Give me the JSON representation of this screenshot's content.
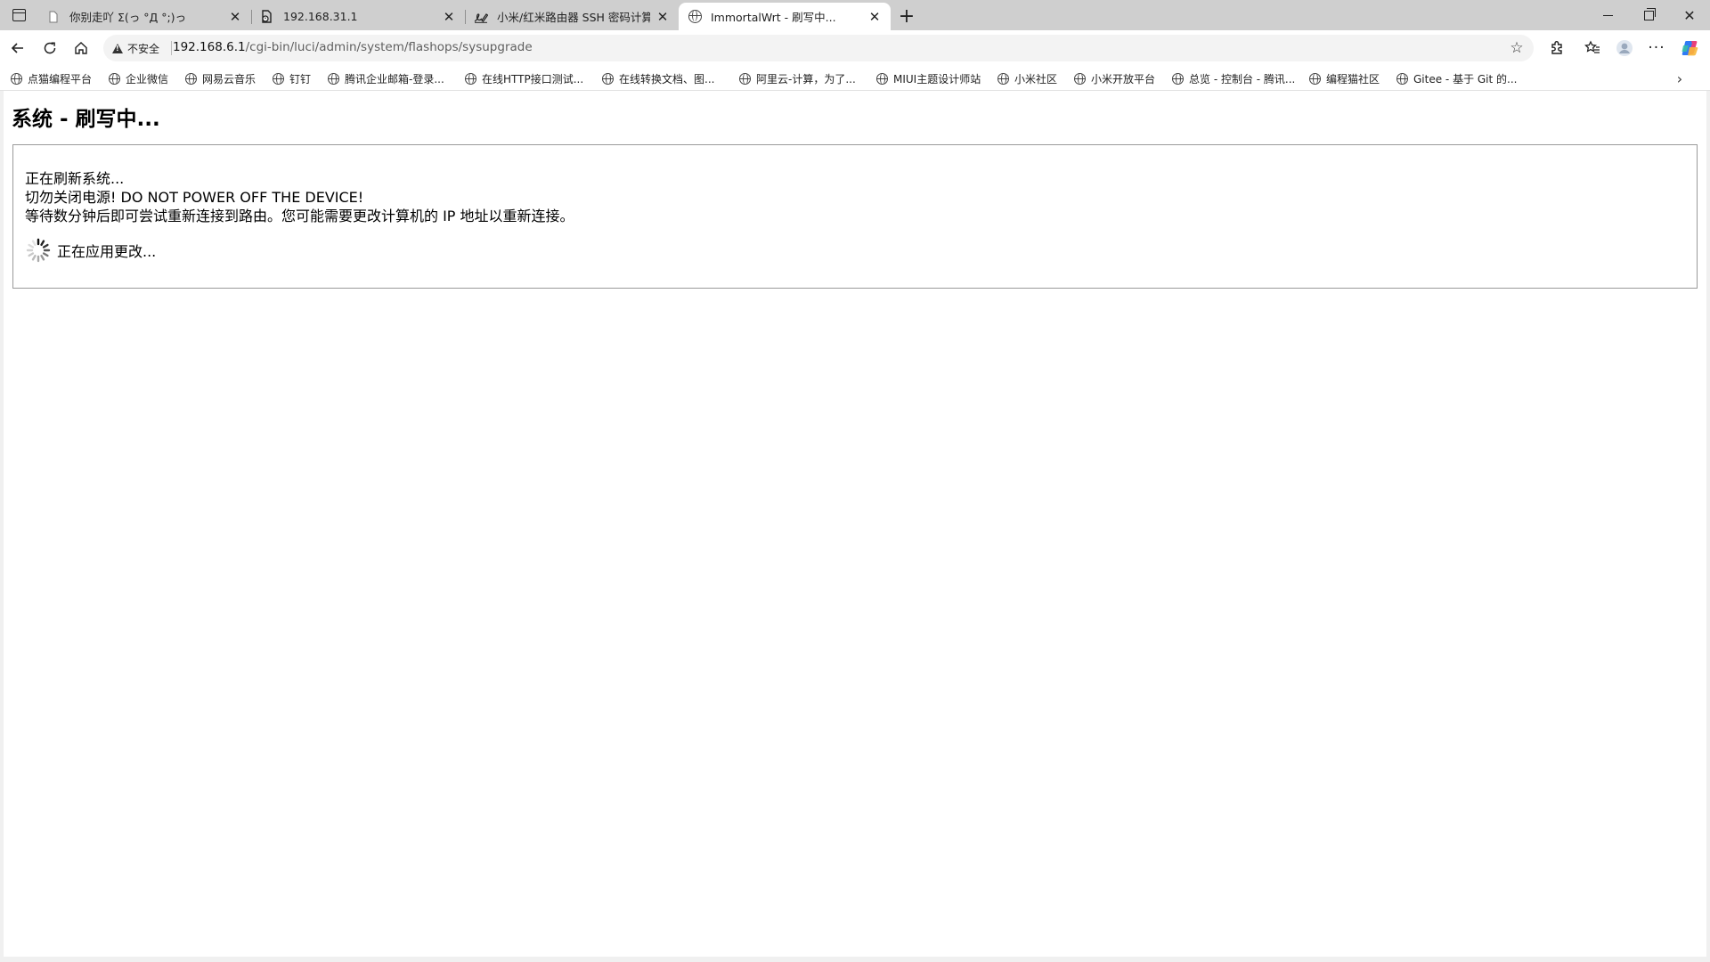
{
  "tabs": [
    {
      "label": "你别走吖 Σ(っ °Д °;)っ",
      "icon": "document-icon",
      "active": false
    },
    {
      "label": "192.168.31.1",
      "icon": "document-error-icon",
      "active": false
    },
    {
      "label": "小米/红米路由器 SSH 密码计算器",
      "icon": "signature-icon",
      "active": false
    },
    {
      "label": "ImmortalWrt - 刷写中...",
      "icon": "globe-icon",
      "active": true
    }
  ],
  "toolbar": {
    "security_label": "不安全",
    "url_host": "192.168.6.1",
    "url_path": "/cgi-bin/luci/admin/system/flashops/sysupgrade"
  },
  "bookmarks": [
    "点猫编程平台",
    "企业微信",
    "网易云音乐",
    "钉钉",
    "腾讯企业邮箱-登录...",
    "在线HTTP接口测试...",
    "在线转换文档、图...",
    "阿里云-计算，为了...",
    "MIUI主题设计师站",
    "小米社区",
    "小米开放平台",
    "总览 - 控制台 - 腾讯...",
    "编程猫社区",
    "Gitee - 基于 Git 的..."
  ],
  "page": {
    "title": "系统 - 刷写中...",
    "line1": "正在刷新系统...",
    "line2": "切勿关闭电源! DO NOT POWER OFF THE DEVICE!",
    "line3": "等待数分钟后即可尝试重新连接到路由。您可能需要更改计算机的 IP 地址以重新连接。",
    "status": "正在应用更改..."
  }
}
